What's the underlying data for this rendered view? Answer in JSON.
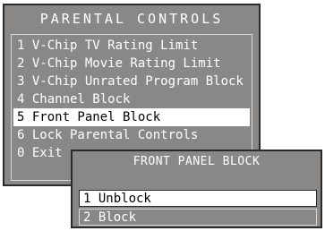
{
  "main_menu": {
    "title": "PARENTAL CONTROLS",
    "items": [
      {
        "label": "1 V-Chip TV Rating Limit",
        "selected": false
      },
      {
        "label": "2 V-Chip Movie Rating Limit",
        "selected": false
      },
      {
        "label": "3 V-Chip Unrated Program Block",
        "selected": false
      },
      {
        "label": "4 Channel Block",
        "selected": false
      },
      {
        "label": "5 Front Panel Block",
        "selected": true
      },
      {
        "label": "6 Lock Parental Controls",
        "selected": false
      },
      {
        "label": "0 Exit",
        "selected": false
      }
    ]
  },
  "submenu": {
    "title": "FRONT PANEL BLOCK",
    "items": [
      {
        "label": "1 Unblock",
        "selected": true
      },
      {
        "label": "2 Block",
        "selected": false
      }
    ]
  },
  "colors": {
    "panel_background": "#8a8887",
    "highlight": "#ffffff",
    "text": "#ffffff",
    "border": "#2a2a2a"
  }
}
